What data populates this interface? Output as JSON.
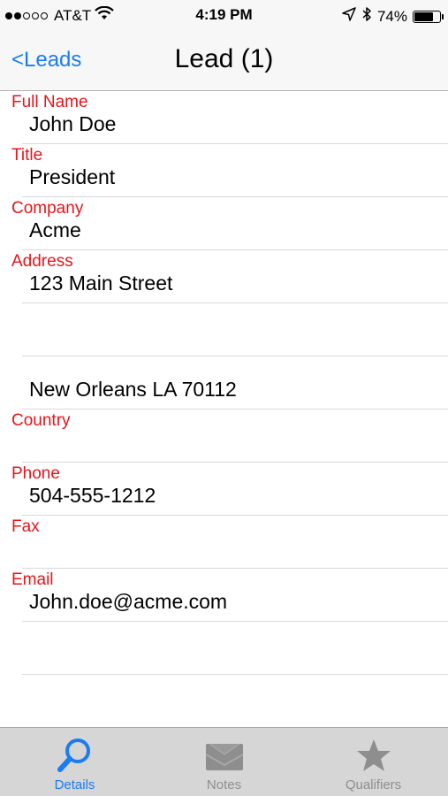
{
  "status_bar": {
    "carrier": "AT&T",
    "time": "4:19 PM",
    "battery_text": "74%",
    "battery_level": 0.74
  },
  "nav": {
    "back_label": "<Leads",
    "title": "Lead (1)"
  },
  "form": {
    "full_name": {
      "label": "Full Name",
      "value": "John  Doe"
    },
    "title": {
      "label": "Title",
      "value": "President"
    },
    "company": {
      "label": "Company",
      "value": "Acme"
    },
    "address": {
      "label": "Address",
      "line1": "123 Main Street",
      "line2": "",
      "city_line": "New Orleans LA 70112"
    },
    "country": {
      "label": "Country",
      "value": ""
    },
    "phone": {
      "label": "Phone",
      "value": "504-555-1212"
    },
    "fax": {
      "label": "Fax",
      "value": ""
    },
    "email": {
      "label": "Email",
      "value": "John.doe@acme.com",
      "extra": ""
    }
  },
  "tabs": [
    {
      "label": "Details",
      "icon": "search-icon",
      "active": true
    },
    {
      "label": "Notes",
      "icon": "envelope-icon",
      "active": false
    },
    {
      "label": "Qualifiers",
      "icon": "star-icon",
      "active": false
    }
  ],
  "colors": {
    "label_red": "#e8141a",
    "accent_blue": "#1a7cf5",
    "inactive_gray": "#8e8e8e"
  }
}
